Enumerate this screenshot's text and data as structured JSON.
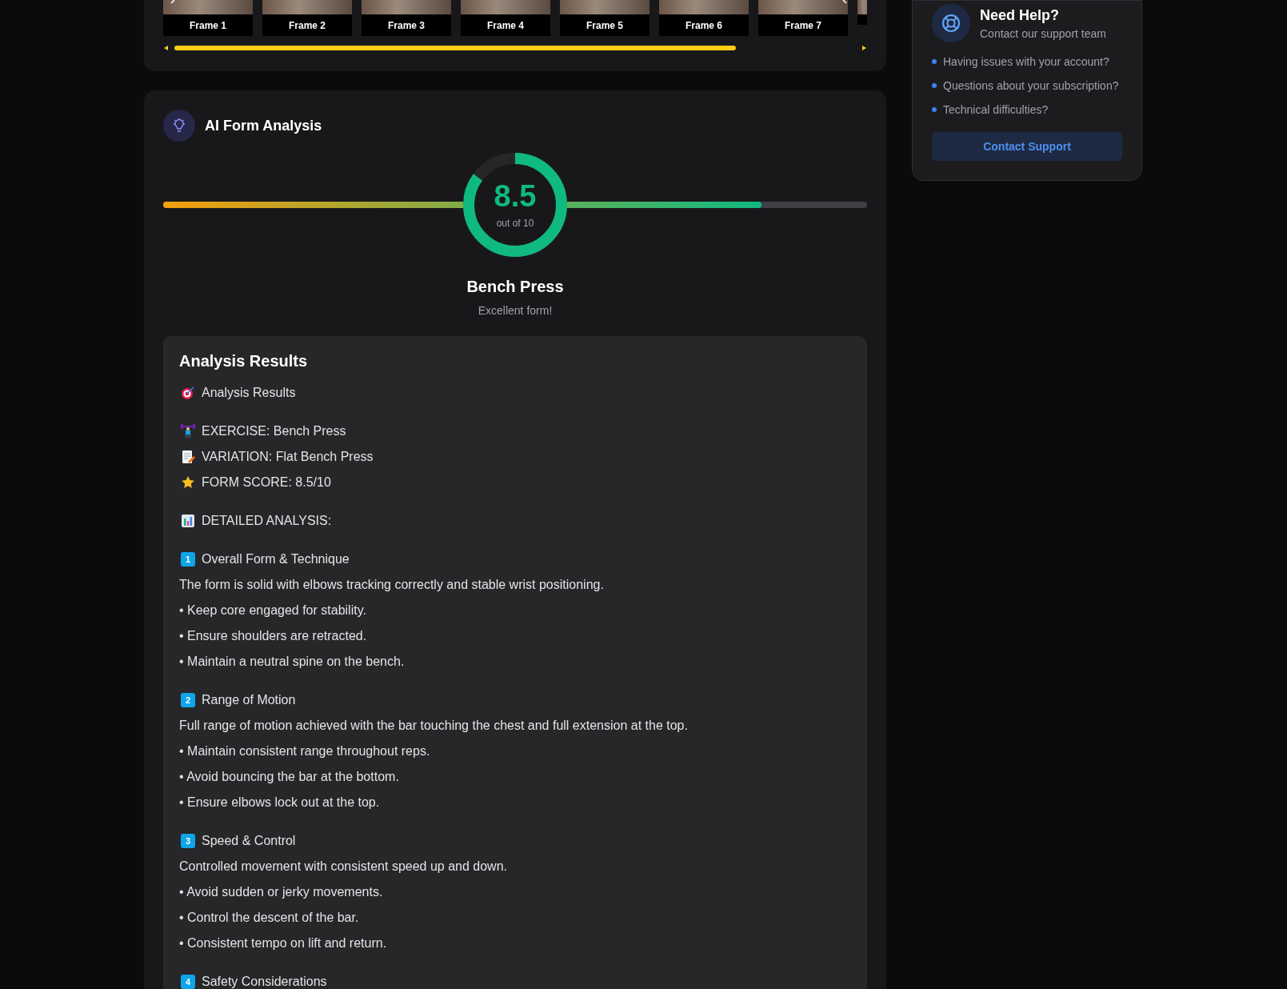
{
  "frames": {
    "items": [
      {
        "label": "Frame 1"
      },
      {
        "label": "Frame 2"
      },
      {
        "label": "Frame 3"
      },
      {
        "label": "Frame 4"
      },
      {
        "label": "Frame 5"
      },
      {
        "label": "Frame 6"
      },
      {
        "label": "Frame 7"
      }
    ]
  },
  "analysis": {
    "title": "AI Form Analysis",
    "score": "8.5",
    "score_caption": "out of 10",
    "level": 0.85,
    "exercise": "Bench Press",
    "verdict": "Excellent form!",
    "results": {
      "title": "Analysis Results",
      "sections": [
        {
          "lines": [
            {
              "kind": "target",
              "text": "Analysis Results"
            }
          ]
        },
        {
          "lines": [
            {
              "kind": "lifter",
              "text": "EXERCISE: Bench Press"
            },
            {
              "kind": "memo",
              "text": "VARIATION: Flat Bench Press"
            },
            {
              "kind": "star",
              "text": "FORM SCORE: 8.5/10"
            }
          ]
        },
        {
          "lines": [
            {
              "kind": "chart",
              "text": "DETAILED ANALYSIS:"
            }
          ]
        },
        {
          "lines": [
            {
              "kind": "keycap",
              "number": "1",
              "text": "Overall Form & Technique"
            },
            {
              "kind": "para",
              "text": "The form is solid with elbows tracking correctly and stable wrist positioning."
            },
            {
              "kind": "bullet",
              "text": "• Keep core engaged for stability."
            },
            {
              "kind": "bullet",
              "text": "• Ensure shoulders are retracted."
            },
            {
              "kind": "bullet",
              "text": "• Maintain a neutral spine on the bench."
            }
          ]
        },
        {
          "lines": [
            {
              "kind": "keycap",
              "number": "2",
              "text": "Range of Motion"
            },
            {
              "kind": "para",
              "text": "Full range of motion achieved with the bar touching the chest and full extension at the top."
            },
            {
              "kind": "bullet",
              "text": "• Maintain consistent range throughout reps."
            },
            {
              "kind": "bullet",
              "text": "• Avoid bouncing the bar at the bottom."
            },
            {
              "kind": "bullet",
              "text": "• Ensure elbows lock out at the top."
            }
          ]
        },
        {
          "lines": [
            {
              "kind": "keycap",
              "number": "3",
              "text": "Speed & Control"
            },
            {
              "kind": "para",
              "text": "Controlled movement with consistent speed up and down."
            },
            {
              "kind": "bullet",
              "text": "• Avoid sudden or jerky movements."
            },
            {
              "kind": "bullet",
              "text": "• Control the descent of the bar."
            },
            {
              "kind": "bullet",
              "text": "• Consistent tempo on lift and return."
            }
          ]
        },
        {
          "lines": [
            {
              "kind": "keycap",
              "number": "4",
              "text": "Safety Considerations"
            }
          ]
        }
      ]
    }
  },
  "help": {
    "title": "Need Help?",
    "subtitle": "Contact our support team",
    "items": [
      "Having issues with your account?",
      "Questions about your subscription?",
      "Technical difficulties?"
    ],
    "button": "Contact Support"
  }
}
